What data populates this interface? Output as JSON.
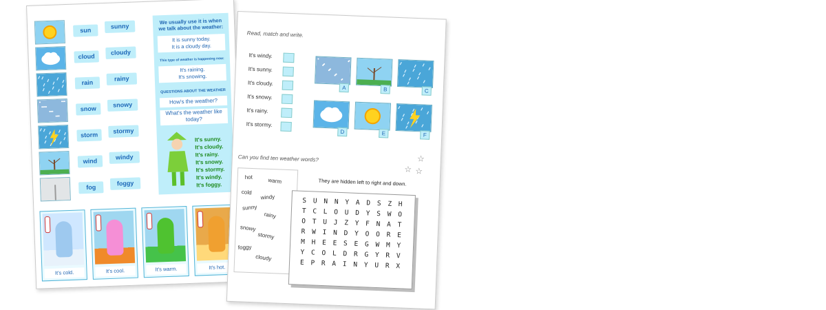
{
  "left_sheet": {
    "weather_rows": [
      {
        "icon": "sun-icon",
        "noun": "sun",
        "adjective": "sunny"
      },
      {
        "icon": "cloud-icon",
        "noun": "cloud",
        "adjective": "cloudy"
      },
      {
        "icon": "rain-icon",
        "noun": "rain",
        "adjective": "rainy"
      },
      {
        "icon": "snow-icon",
        "noun": "snow",
        "adjective": "snowy"
      },
      {
        "icon": "storm-icon",
        "noun": "storm",
        "adjective": "stormy"
      },
      {
        "icon": "wind-icon",
        "noun": "wind",
        "adjective": "windy"
      },
      {
        "icon": "fog-icon",
        "noun": "fog",
        "adjective": "foggy"
      }
    ],
    "panel": {
      "intro_1": "We usually use it is when",
      "intro_2": "we talk about the weather:",
      "ex_1": "It is sunny today.",
      "ex_2": "It is a cloudy day.",
      "happening": "This type of weather is happening now:",
      "ex_3": "It's raining.",
      "ex_4": "It's snowing.",
      "questions_title": "QUESTIONS ABOUT THE WEATHER",
      "q1": "How's the weather?",
      "q2": "What's the weather like today?",
      "answers": [
        "It's sunny.",
        "It's cloudy.",
        "It's rainy.",
        "It's snowy.",
        "It's stormy.",
        "It's windy.",
        "It's foggy."
      ]
    },
    "cards": [
      "It's cold.",
      "It's cool.",
      "It's warm.",
      "It's hot."
    ]
  },
  "right_sheet": {
    "instruction_1": "Read, match and write.",
    "sentences": [
      "It's windy.",
      "It's sunny.",
      "It's cloudy.",
      "It's snowy.",
      "It's rainy.",
      "It's stormy."
    ],
    "picture_letters": [
      "A",
      "B",
      "C",
      "D",
      "E",
      "F"
    ],
    "instruction_2": "Can you find ten weather words?",
    "hint": "They are hidden left to right and down.",
    "words": [
      "hot",
      "warm",
      "cold",
      "windy",
      "sunny",
      "rainy",
      "snowy",
      "stormy",
      "foggy",
      "cloudy"
    ],
    "grid": [
      "SUNNYADSZH",
      "TCLOUDYSWO",
      "OTUJZYFNAT",
      "RWINDYOORE",
      "MHEESEGWMY",
      "YCOLDRGYRV",
      "EPRAINYURX"
    ]
  },
  "colors": {
    "accent_blue": "#1f65b2",
    "panel_cyan": "#bfeefa",
    "green_text": "#1e8a1e"
  }
}
